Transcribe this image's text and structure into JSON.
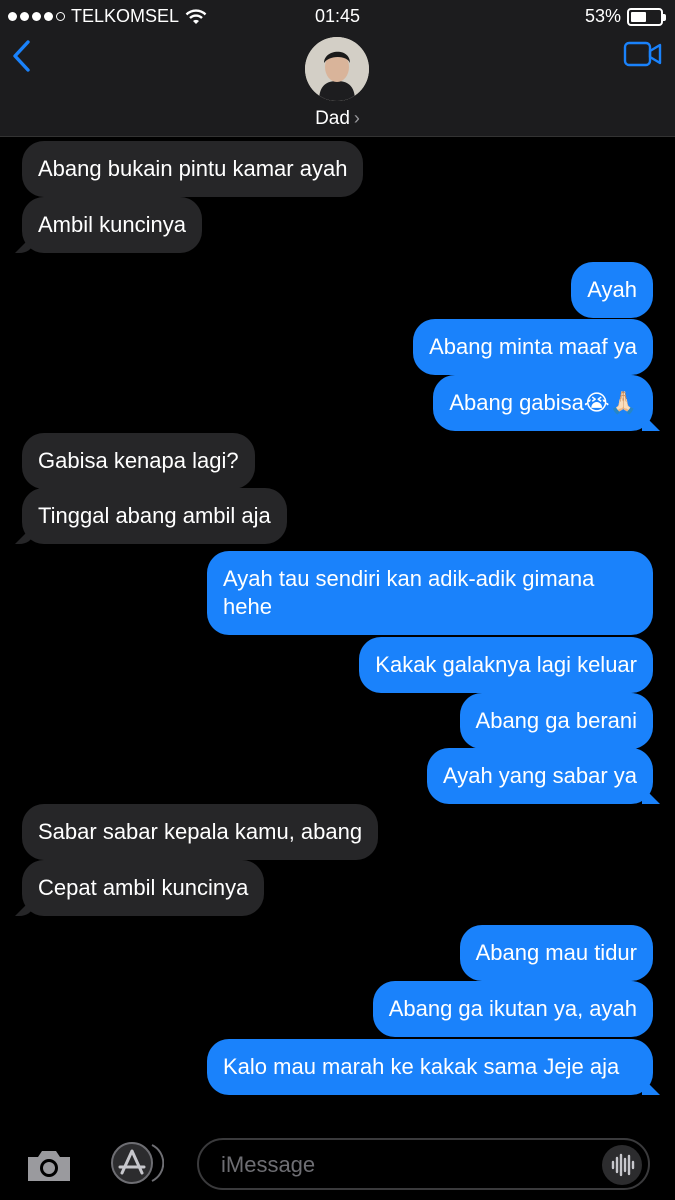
{
  "status_bar": {
    "carrier": "TELKOMSEL",
    "time": "01:45",
    "battery_percent": "53%",
    "battery_level": 0.53
  },
  "header": {
    "contact_name": "Dad"
  },
  "messages": [
    {
      "dir": "in",
      "text": "Abang bukain pintu kamar ayah"
    },
    {
      "dir": "in",
      "text": "Ambil kuncinya"
    },
    {
      "dir": "out",
      "text": "Ayah"
    },
    {
      "dir": "out",
      "text": "Abang minta maaf ya"
    },
    {
      "dir": "out",
      "text": "Abang gabisa😭🙏🏻"
    },
    {
      "dir": "in",
      "text": "Gabisa kenapa lagi?"
    },
    {
      "dir": "in",
      "text": "Tinggal abang ambil aja"
    },
    {
      "dir": "out",
      "text": "Ayah tau sendiri kan adik-adik gimana hehe"
    },
    {
      "dir": "out",
      "text": "Kakak galaknya lagi keluar"
    },
    {
      "dir": "out",
      "text": "Abang ga berani"
    },
    {
      "dir": "out",
      "text": "Ayah yang sabar ya"
    },
    {
      "dir": "in",
      "text": "Sabar sabar kepala kamu, abang"
    },
    {
      "dir": "in",
      "text": "Cepat ambil kuncinya"
    },
    {
      "dir": "out",
      "text": "Abang mau tidur"
    },
    {
      "dir": "out",
      "text": "Abang ga ikutan ya, ayah"
    },
    {
      "dir": "out",
      "text": "Kalo mau marah ke kakak sama Jeje aja"
    }
  ],
  "composer": {
    "placeholder": "iMessage"
  },
  "colors": {
    "outgoing_bubble": "#1a82fb",
    "incoming_bubble": "#262628",
    "accent": "#1a82fb"
  }
}
